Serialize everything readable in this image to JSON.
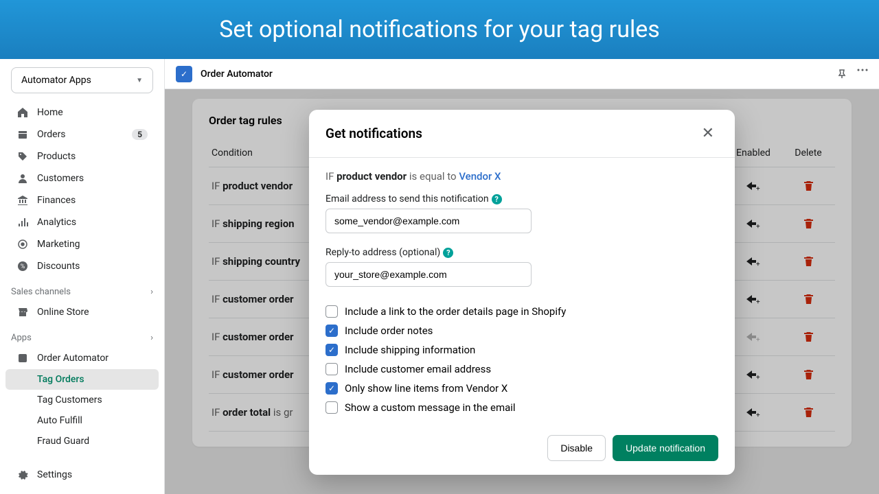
{
  "hero": "Set optional notifications for your tag rules",
  "dropdown": {
    "label": "Automator Apps"
  },
  "nav": [
    {
      "label": "Home"
    },
    {
      "label": "Orders",
      "badge": "5"
    },
    {
      "label": "Products"
    },
    {
      "label": "Customers"
    },
    {
      "label": "Finances"
    },
    {
      "label": "Analytics"
    },
    {
      "label": "Marketing"
    },
    {
      "label": "Discounts"
    }
  ],
  "section_sales": "Sales channels",
  "online_store": "Online Store",
  "section_apps": "Apps",
  "app_item": "Order Automator",
  "sub_items": [
    "Tag Orders",
    "Tag Customers",
    "Auto Fulfill",
    "Fraud Guard"
  ],
  "settings": "Settings",
  "topbar_app": "Order Automator",
  "card_title": "Order tag rules",
  "columns": {
    "condition": "Condition",
    "enabled": "Enabled",
    "delete": "Delete"
  },
  "rows": [
    {
      "pre": "IF ",
      "field": "product vendor"
    },
    {
      "pre": "IF ",
      "field": "shipping region"
    },
    {
      "pre": "IF ",
      "field": "shipping country"
    },
    {
      "pre": "IF ",
      "field": "customer order"
    },
    {
      "pre": "IF ",
      "field": "customer order",
      "disabled": true
    },
    {
      "pre": "IF ",
      "field": "customer order"
    },
    {
      "pre": "IF ",
      "field": "order total",
      "suffix": " is gr"
    }
  ],
  "modal": {
    "title": "Get notifications",
    "condition": {
      "pre": "IF ",
      "field": "product vendor",
      "op": " is equal to ",
      "value": "Vendor X"
    },
    "email_label": "Email address to send this notification",
    "email_value": "some_vendor@example.com",
    "reply_label": "Reply-to address (optional)",
    "reply_value": "your_store@example.com",
    "checks": [
      {
        "label": "Include a link to the order details page in Shopify",
        "checked": false
      },
      {
        "label": "Include order notes",
        "checked": true
      },
      {
        "label": "Include shipping information",
        "checked": true
      },
      {
        "label": "Include customer email address",
        "checked": false
      },
      {
        "label": "Only show line items from Vendor X",
        "checked": true
      },
      {
        "label": "Show a custom message in the email",
        "checked": false
      }
    ],
    "disable": "Disable",
    "submit": "Update notification"
  }
}
